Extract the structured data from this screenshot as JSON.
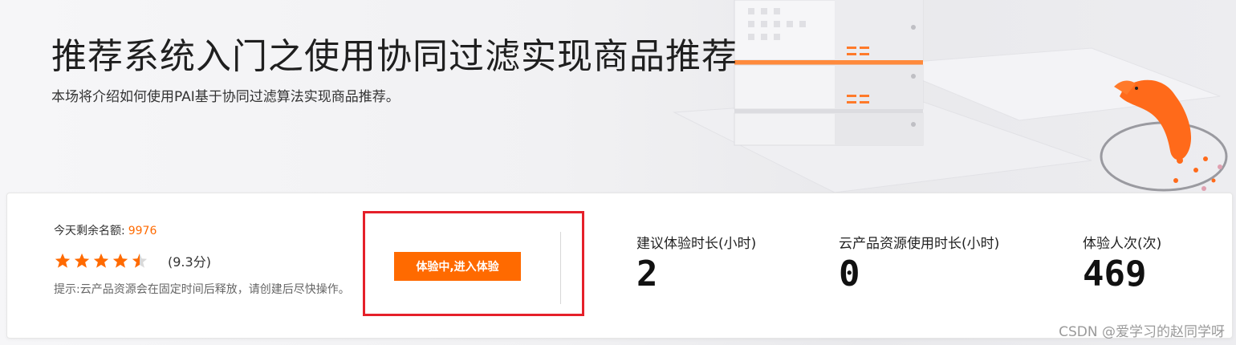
{
  "hero": {
    "title": "推荐系统入门之使用协同过滤实现商品推荐",
    "subtitle": "本场将介绍如何使用PAI基于协同过滤算法实现商品推荐。"
  },
  "card": {
    "quota_label": "今天剩余名额:",
    "quota_value": "9976",
    "rating": {
      "filled_stars": 4.5,
      "max_stars": 5,
      "score_text": "(9.3分)"
    },
    "tip_label": "提示:",
    "tip_text": "云产品资源会在固定时间后释放，请创建后尽快操作。",
    "enter_button": "体验中,进入体验",
    "stats": [
      {
        "label": "建议体验时长(小时)",
        "value": "2"
      },
      {
        "label": "云产品资源使用时长(小时)",
        "value": "0"
      },
      {
        "label": "体验人次(次)",
        "value": "469"
      }
    ]
  },
  "colors": {
    "accent": "#ff6a00",
    "highlight_border": "#e5202a",
    "star": "#ff6a00"
  },
  "watermark": "CSDN @爱学习的赵同学呀"
}
